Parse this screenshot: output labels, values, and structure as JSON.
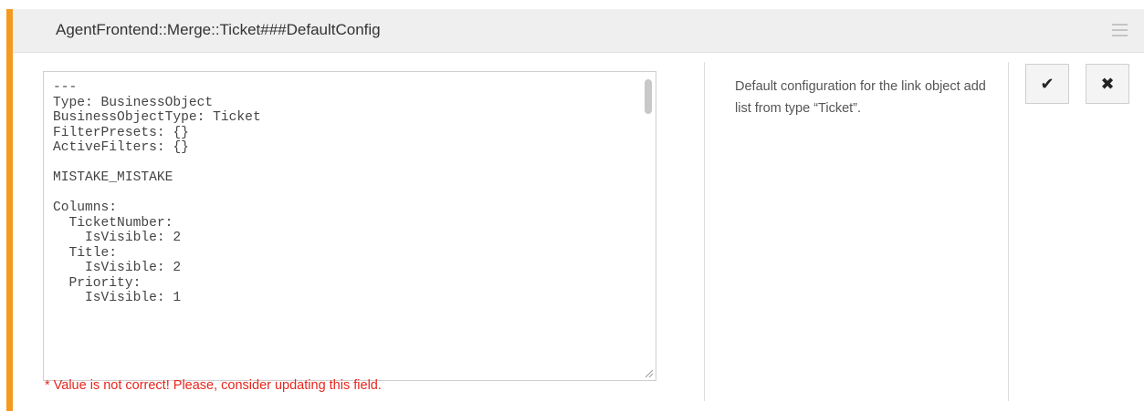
{
  "setting": {
    "title": "AgentFrontend::Merge::Ticket###DefaultConfig",
    "value_lines": [
      "---",
      "Type: BusinessObject",
      "BusinessObjectType: Ticket",
      "FilterPresets: {}",
      "ActiveFilters: {}",
      "",
      "MISTAKE_MISTAKE",
      "",
      "Columns:",
      "  TicketNumber:",
      "    IsVisible: 2",
      "  Title:",
      "    IsVisible: 2",
      "  Priority:",
      "    IsVisible: 1"
    ],
    "error_message": "* Value is not correct! Please, consider updating this field.",
    "description": "Default configuration for the link object add list from type “Ticket”."
  },
  "actions": {
    "save_icon": "✔",
    "cancel_icon": "✖"
  },
  "icons": {
    "menu": "hamburger-menu-icon",
    "save": "checkmark-icon",
    "cancel": "close-icon"
  },
  "colors": {
    "accent": "#f5991f",
    "error": "#e8251c",
    "header_bg": "#efefef"
  }
}
